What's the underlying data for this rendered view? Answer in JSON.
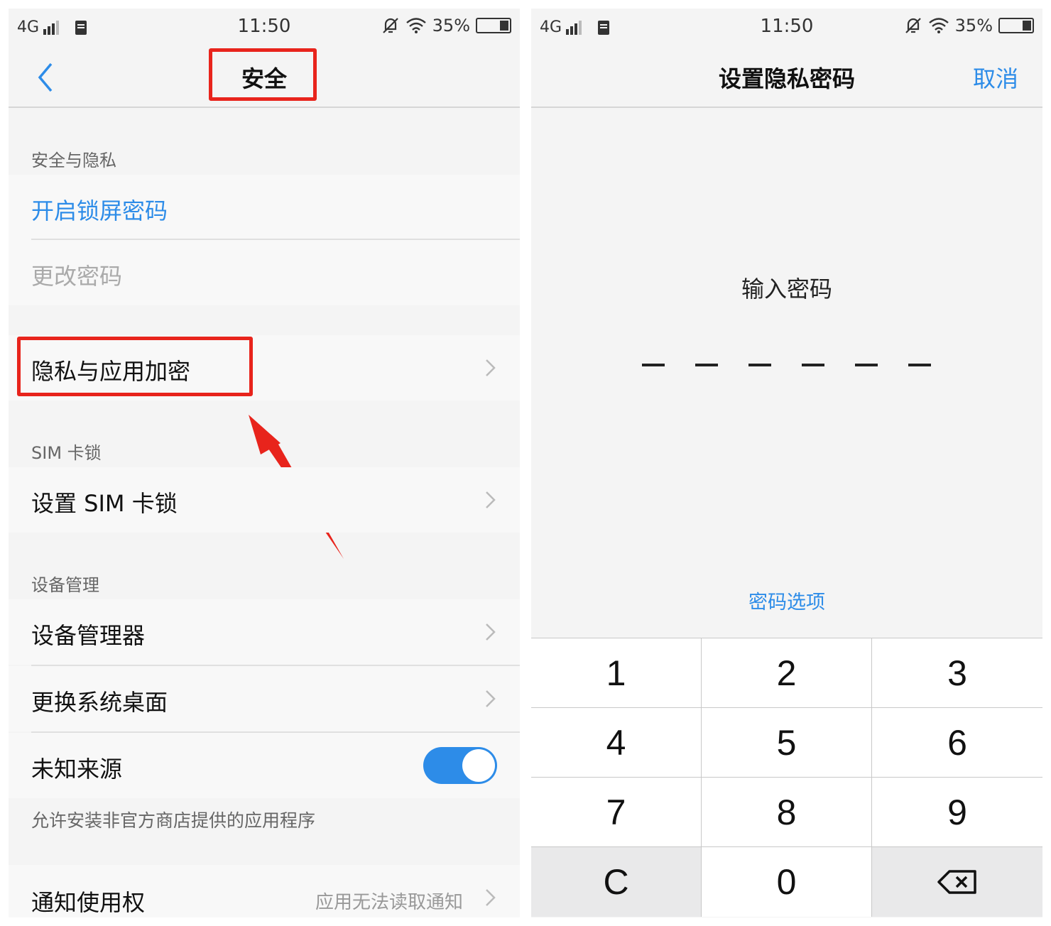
{
  "status_bar": {
    "network": "4G",
    "time": "11:50",
    "battery": "35%"
  },
  "left": {
    "title": "安全",
    "sections": {
      "security_privacy": "安全与隐私",
      "sim_lock": "SIM 卡锁",
      "device_management": "设备管理"
    },
    "items": {
      "enable_lock_password": "开启锁屏密码",
      "change_password": "更改密码",
      "privacy_app_encryption": "隐私与应用加密",
      "set_sim_lock": "设置 SIM 卡锁",
      "device_admin": "设备管理器",
      "change_launcher": "更换系统桌面",
      "unknown_sources": "未知来源",
      "unknown_sources_desc": "允许安装非官方商店提供的应用程序",
      "notification_access": "通知使用权",
      "notification_access_value": "应用无法读取通知"
    },
    "unknown_sources_enabled": true
  },
  "right": {
    "title": "设置隐私密码",
    "cancel": "取消",
    "prompt": "输入密码",
    "password_length": 6,
    "password_options": "密码选项",
    "keys": [
      "1",
      "2",
      "3",
      "4",
      "5",
      "6",
      "7",
      "8",
      "9",
      "C",
      "0"
    ]
  },
  "colors": {
    "accent": "#2d8ce8",
    "highlight": "#e8241c"
  },
  "icons": [
    "back-chevron-icon",
    "chevron-right-icon",
    "backspace-icon",
    "signal-icon",
    "wifi-icon",
    "mute-icon",
    "sim-icon",
    "battery-icon"
  ]
}
